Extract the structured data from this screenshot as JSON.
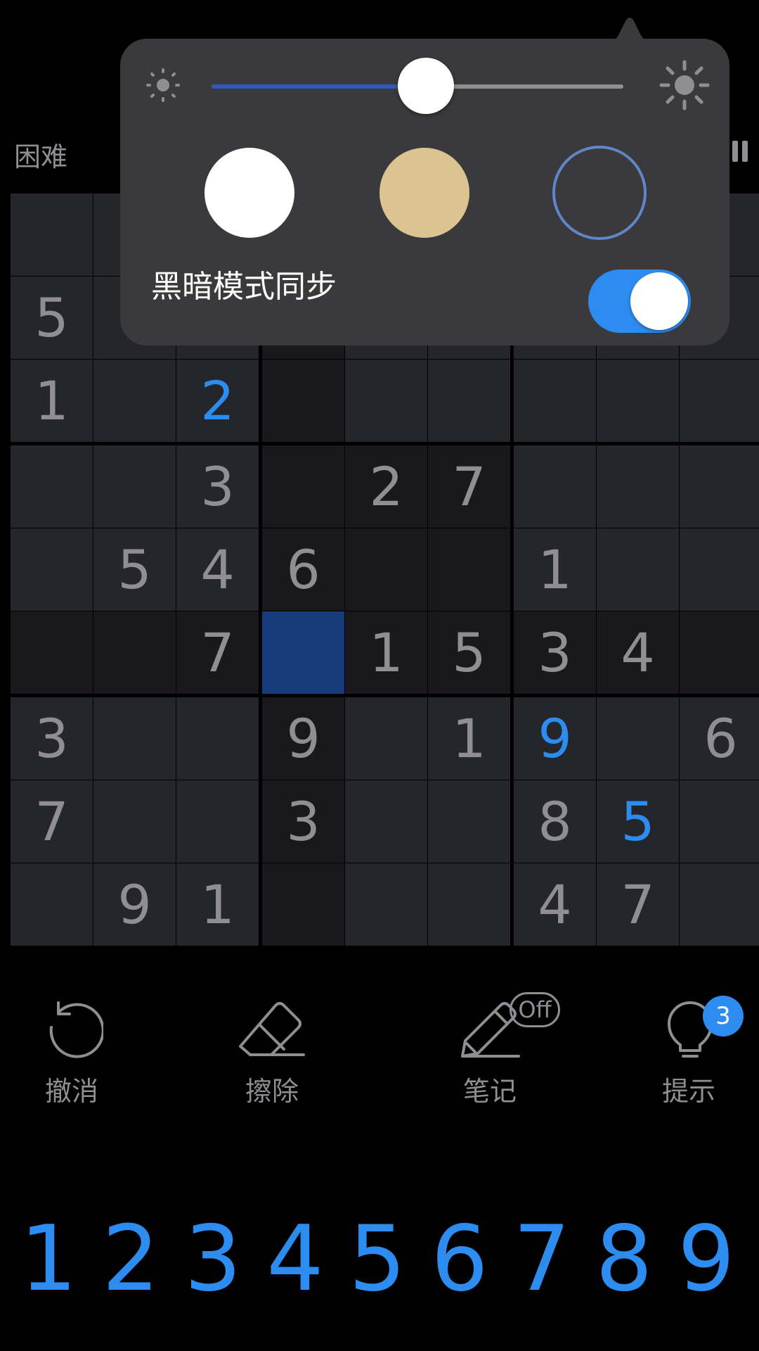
{
  "header": {
    "difficulty": "困难"
  },
  "popover": {
    "brightness_percent": 52,
    "color_options": [
      "white",
      "beige",
      "dark"
    ],
    "dark_mode_sync_label": "黑暗模式同步",
    "dark_mode_sync_on": true
  },
  "board": {
    "rows": [
      [
        "",
        "",
        "",
        "",
        "",
        "",
        "",
        "",
        ""
      ],
      [
        "5",
        "",
        "",
        "",
        "",
        "",
        "",
        "",
        ""
      ],
      [
        "1",
        "",
        "2",
        "",
        "",
        "",
        "",
        "",
        ""
      ],
      [
        "",
        "",
        "3",
        "",
        "2",
        "7",
        "",
        "",
        ""
      ],
      [
        "",
        "5",
        "4",
        "6",
        "",
        "",
        "1",
        "",
        ""
      ],
      [
        "",
        "",
        "7",
        "",
        "1",
        "5",
        "3",
        "4",
        ""
      ],
      [
        "3",
        "",
        "",
        "9",
        "",
        "1",
        "9",
        "",
        "6"
      ],
      [
        "7",
        "",
        "",
        "3",
        "",
        "",
        "8",
        "5",
        ""
      ],
      [
        "",
        "9",
        "1",
        "",
        "",
        "",
        "4",
        "7",
        ""
      ]
    ],
    "user_entries": [
      "2-2",
      "6-6",
      "7-7"
    ],
    "selected_cell": "5-3"
  },
  "toolbar": {
    "undo_label": "撤消",
    "erase_label": "擦除",
    "notes_label": "笔记",
    "notes_state": "Off",
    "hint_label": "提示",
    "hint_count": "3"
  },
  "numpad": [
    "1",
    "2",
    "3",
    "4",
    "5",
    "6",
    "7",
    "8",
    "9"
  ],
  "colors": {
    "accent": "#2d8cf0",
    "selected": "#163d7a",
    "given_digit": "#8e8e93"
  }
}
